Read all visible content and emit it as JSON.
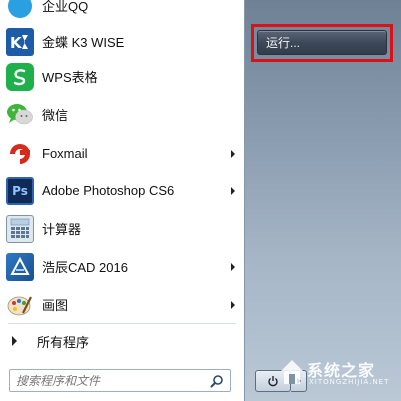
{
  "programs": [
    {
      "label": "企业QQ",
      "icon": "enterprise-qq-icon",
      "has_submenu": false
    },
    {
      "label": "金蝶 K3 WISE",
      "icon": "kingdee-k3-icon",
      "has_submenu": false
    },
    {
      "label": "WPS表格",
      "icon": "wps-spreadsheet-icon",
      "has_submenu": false
    },
    {
      "label": "微信",
      "icon": "wechat-icon",
      "has_submenu": false
    },
    {
      "label": "Foxmail",
      "icon": "foxmail-icon",
      "has_submenu": true
    },
    {
      "label": "Adobe Photoshop CS6",
      "icon": "photoshop-icon",
      "has_submenu": true
    },
    {
      "label": "计算器",
      "icon": "calculator-icon",
      "has_submenu": false
    },
    {
      "label": "浩辰CAD 2016",
      "icon": "gstarcad-icon",
      "has_submenu": true
    },
    {
      "label": "画图",
      "icon": "paint-icon",
      "has_submenu": true
    }
  ],
  "all_programs": {
    "label": "所有程序"
  },
  "search": {
    "placeholder": "搜索程序和文件"
  },
  "right_pane": {
    "run_label": "运行..."
  },
  "watermark": {
    "text": "系统之家",
    "sub": "XITONGZHIJIA.NET"
  },
  "colors": {
    "highlight": "#d81318",
    "right_pane": "#8799ad"
  }
}
